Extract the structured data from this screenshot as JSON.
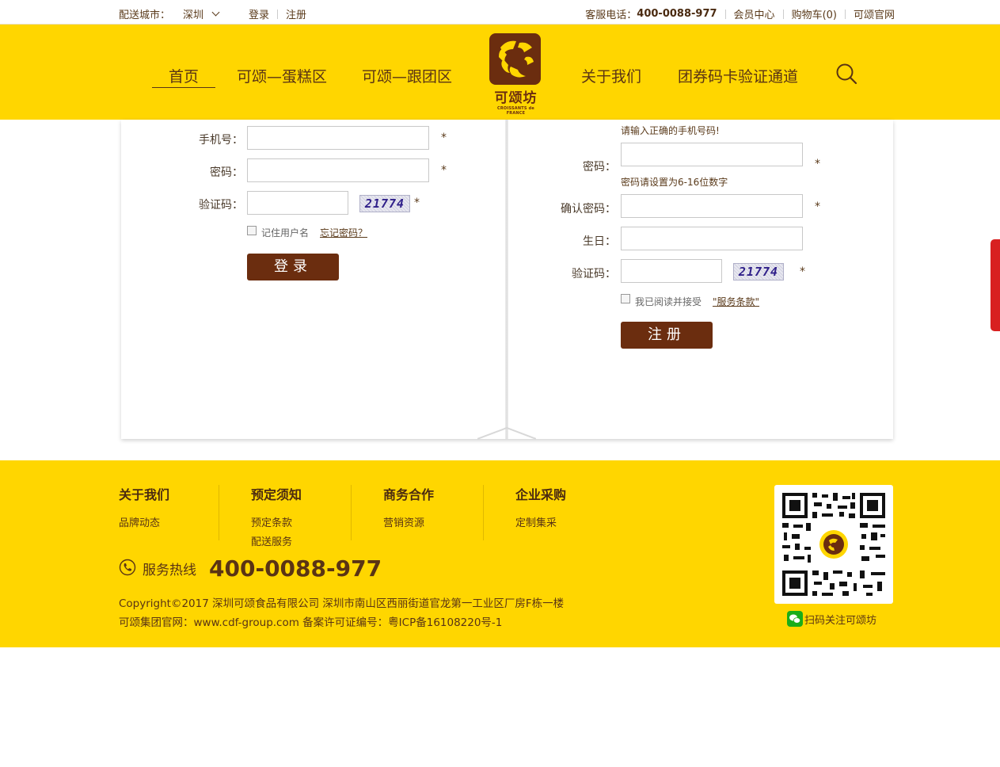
{
  "topbar": {
    "city_label": "配送城市：",
    "city_value": "深圳",
    "login": "登录",
    "register": "注册",
    "service_label": "客服电话：",
    "service_phone": "400-0088-977",
    "member_center": "会员中心",
    "cart": "购物车(0)",
    "official_site": "可颂官网"
  },
  "nav": {
    "home": "首页",
    "cake_zone": "可颂—蛋糕区",
    "group_zone": "可颂—跟团区",
    "about": "关于我们",
    "voucher": "团券码卡验证通道",
    "logo_name": "可颂坊",
    "logo_sub": "CROISSANTS de FRANCE"
  },
  "login_form": {
    "phone_label": "手机号：",
    "password_label": "密码：",
    "captcha_label": "验证码：",
    "captcha_code": "21774",
    "required_mark": "*",
    "remember": "记住用户名",
    "forgot": "忘记密码？",
    "submit": "登录"
  },
  "register_form": {
    "phone_hint": "请输入正确的手机号码!",
    "password_label": "密码：",
    "password_hint": "密码请设置为6-16位数字",
    "confirm_label": "确认密码：",
    "birthday_label": "生日：",
    "captcha_label": "验证码：",
    "captcha_code": "21774",
    "required_mark": "*",
    "agree_text": "我已阅读并接受",
    "terms": "\"服务条款\"",
    "submit": "注册"
  },
  "footer": {
    "columns": [
      {
        "title": "关于我们",
        "items": [
          "品牌动态"
        ]
      },
      {
        "title": "预定须知",
        "items": [
          "预定条款",
          "配送服务"
        ]
      },
      {
        "title": "商务合作",
        "items": [
          "营销资源"
        ]
      },
      {
        "title": "企业采购",
        "items": [
          "定制集采"
        ]
      }
    ],
    "hotline_label": "服务热线",
    "hotline_number": "400-0088-977",
    "copyright_line1": "Copyright©2017 深圳可颂食品有限公司 深圳市南山区西丽街道官龙第一工业区厂房F栋一楼",
    "copyright_line2": "可颂集团官网：www.cdf-group.com 备案许可证编号：粤ICP备16108220号-1",
    "qr_caption": "扫码关注可颂坊"
  },
  "colors": {
    "brand_yellow": "#ffd600",
    "brand_brown": "#6b2d0f",
    "side_tab_red": "#d82020"
  }
}
